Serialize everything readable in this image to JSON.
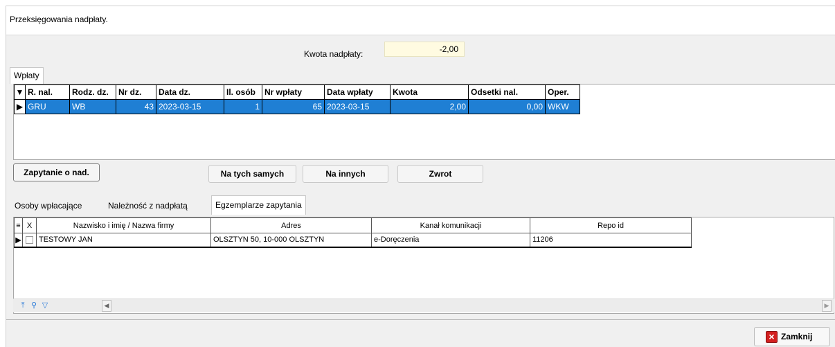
{
  "window": {
    "title": "Przeksięgowania nadpłaty."
  },
  "overpayment": {
    "label": "Kwota nadpłaty:",
    "value": "-2,00"
  },
  "top_tabs": [
    {
      "label": "Wpłaty"
    }
  ],
  "payments_grid": {
    "columns": [
      "R. nal.",
      "Rodz. dz.",
      "Nr dz.",
      "Data dz.",
      "Il. osób",
      "Nr wpłaty",
      "Data wpłaty",
      "Kwota",
      "Odsetki nal.",
      "Oper."
    ],
    "rows": [
      [
        "GRU",
        "WB",
        "43",
        "2023-03-15",
        "1",
        "65",
        "2023-03-15",
        "2,00",
        "0,00",
        "WKW"
      ]
    ]
  },
  "buttons": {
    "query": "Zapytanie o nad.",
    "same": "Na tych samych",
    "other": "Na innych",
    "refund": "Zwrot",
    "close": "Zamknij"
  },
  "bottom_tabs": [
    {
      "label": "Osoby wpłacające"
    },
    {
      "label": "Należność z nadpłatą"
    },
    {
      "label": "Egzemplarze zapytania"
    }
  ],
  "copies_grid": {
    "columns": [
      "X",
      "Nazwisko i imię / Nazwa firmy",
      "Adres",
      "Kanał komunikacji",
      "Repo id"
    ],
    "rows": [
      [
        "",
        "TESTOWY JAN",
        "OLSZTYN 50, 10-000 OLSZTYN",
        "e-Doręczenia",
        "11206"
      ]
    ]
  },
  "colors": {
    "selection": "#1f7fd4",
    "amount_bg": "#fffbe1",
    "close_icon": "#d32020"
  }
}
